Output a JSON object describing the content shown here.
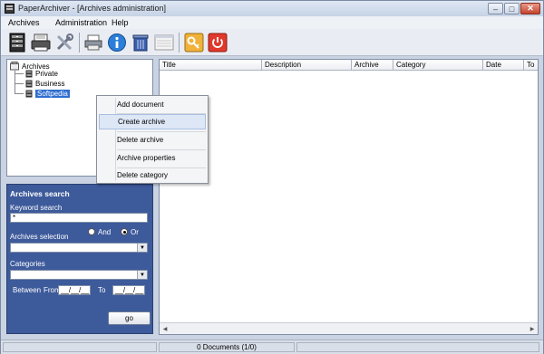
{
  "window": {
    "title": "PaperArchiver - [Archives administration]"
  },
  "menu": {
    "items": [
      "Archives",
      "Administration",
      "Help"
    ]
  },
  "toolbar": {
    "buttons": [
      "archives-tree-icon",
      "scanner-icon",
      "tools-icon",
      "printer-icon",
      "info-icon",
      "recycle-bin-icon",
      "window-icon",
      "key-icon",
      "power-icon"
    ]
  },
  "tree": {
    "root": "Archives",
    "children": [
      "Private",
      "Business",
      "Softpedia"
    ],
    "selected": "Softpedia"
  },
  "context_menu": {
    "items": [
      "Add document",
      "Create archive",
      "Delete archive",
      "Archive properties",
      "Delete category"
    ],
    "hovered": "Create archive"
  },
  "search": {
    "header": "Archives search",
    "keyword_label": "Keyword search",
    "keyword_value": "*",
    "archives_selection_label": "Archives selection",
    "and_label": "And",
    "or_label": "Or",
    "or_selected": true,
    "categories_label": "Categories",
    "between_label": "Between",
    "from_label": "From",
    "to_label": "To",
    "from_value": "__/__/__",
    "to_value": "__/__/__",
    "go_label": "go"
  },
  "list": {
    "columns": [
      "Title",
      "Description",
      "Archive",
      "Category",
      "Date",
      "To"
    ]
  },
  "status": {
    "text": "0 Documents  (1/0)"
  },
  "colors": {
    "search_panel": "#3d5a9b",
    "selection": "#2e6dd1",
    "power_button": "#e0392b",
    "key_button": "#f0b23a"
  }
}
